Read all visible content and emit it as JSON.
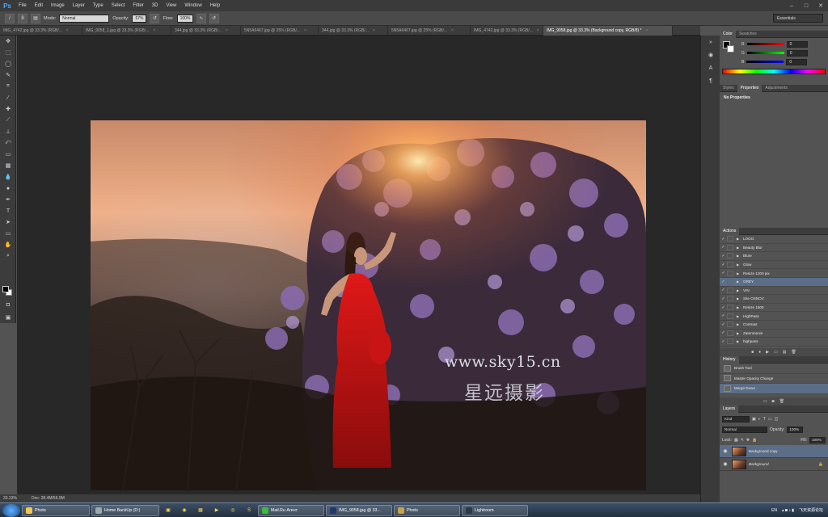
{
  "app": {
    "logo": "Ps"
  },
  "menu": [
    "File",
    "Edit",
    "Image",
    "Layer",
    "Type",
    "Select",
    "Filter",
    "3D",
    "View",
    "Window",
    "Help"
  ],
  "options_bar": {
    "brush_size": "8",
    "mode_label": "Mode:",
    "mode_value": "Normal",
    "opacity_label": "Opacity:",
    "opacity_value": "67%",
    "flow_label": "Flow:",
    "flow_value": "100%",
    "workspace": "Essentials"
  },
  "doc_tabs": [
    "IMG_4742.jpg @ 33.3% (RGB/...",
    "IMG_9058_1.jpg @ 33.3% (RGB/...",
    "344.jpg @ 33.3% (RGB/...",
    "5N5A6467.jpg @ 25% (RGB/...",
    "344.jpg @ 33.3% (RGB/...",
    "5N5A6467.jpg @ 25% (RGB/...",
    "IMG_4742.jpg @ 33.3% (RGB/...",
    "IMG_9058.jpg @ 33.3% (Background copy, RGB/8) *"
  ],
  "watermark": {
    "url": "www.sky15.cn",
    "chinese": "星远摄影"
  },
  "status": {
    "zoom": "33.33%",
    "doc": "Doc: 28.4M/56.9M"
  },
  "color_panel": {
    "tabs": [
      "Color",
      "Swatches"
    ],
    "channels": [
      {
        "label": "R",
        "value": "0"
      },
      {
        "label": "G",
        "value": "0"
      },
      {
        "label": "B",
        "value": "0"
      }
    ]
  },
  "properties_panel": {
    "tabs": [
      "Styles",
      "Properties",
      "Adjustments"
    ],
    "content": "No Properties"
  },
  "actions_panel": {
    "title": "Actions",
    "items": [
      "LOGO",
      "Beauty Blur",
      "Blure",
      "Glow",
      "Resize 1200 pix",
      "GREY",
      "VIN",
      "Site OSNOV",
      "Resize 1500",
      "HighPass",
      "Contrast",
      "Zatemnenie",
      "highpass"
    ],
    "selected_index": 5
  },
  "history_panel": {
    "title": "History",
    "items": [
      "Brush Tool",
      "Master Opacity Change",
      "Merge Down"
    ],
    "selected_index": 2
  },
  "layers_panel": {
    "title": "Layers",
    "filter": "Kind",
    "blend_mode": "Normal",
    "opacity_label": "Opacity:",
    "opacity_value": "100%",
    "lock_label": "Lock:",
    "fill_label": "Fill:",
    "fill_value": "100%",
    "layers": [
      {
        "name": "Background copy",
        "selected": true
      },
      {
        "name": "Background",
        "selected": false
      }
    ]
  },
  "taskbar": {
    "items": [
      "Photo",
      "Home BackUp (D:)",
      "Mail.Ru Агент",
      "IMG_9058.jpg @ 33...",
      "Photo",
      "Lightroom"
    ],
    "lang": "EN",
    "tray_text": "飞天资源论坛"
  },
  "colors": {
    "accent_selection": "#5b6e88",
    "panel_bg": "#535353",
    "canvas_bg": "#282828",
    "ps_blue": "#4aa8ff"
  }
}
